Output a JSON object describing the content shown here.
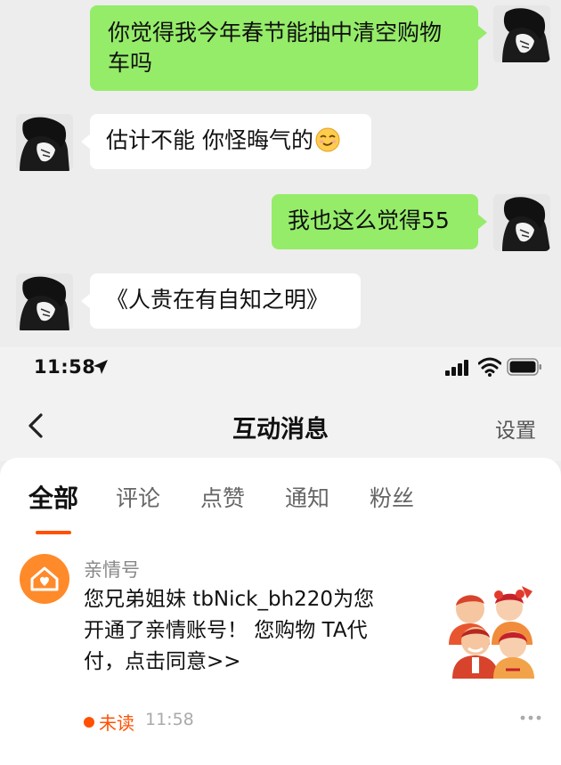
{
  "chat": {
    "messages": [
      {
        "side": "right",
        "text_line1": "你觉得我今年春节能抽中清空购物",
        "text_line2": "车吗"
      },
      {
        "side": "left",
        "text": "估计不能 你怪晦气的",
        "emoji": "smirk-emoji"
      },
      {
        "side": "right",
        "text": "我也这么觉得55"
      },
      {
        "side": "left",
        "text": "《人贵在有自知之明》"
      }
    ],
    "bubble_color_right": "#95ec69",
    "bubble_color_left": "#ffffff"
  },
  "status_bar": {
    "time": "11:58",
    "icons": [
      "location-arrow-icon",
      "signal-icon",
      "wifi-icon",
      "battery-icon"
    ]
  },
  "nav": {
    "back_icon": "chevron-left-icon",
    "title": "互动消息",
    "settings": "设置"
  },
  "tabs": [
    {
      "label": "全部",
      "active": true
    },
    {
      "label": "评论",
      "active": false
    },
    {
      "label": "点赞",
      "active": false
    },
    {
      "label": "通知",
      "active": false
    },
    {
      "label": "粉丝",
      "active": false
    }
  ],
  "notification": {
    "icon": "family-house-icon",
    "sender": "亲情号",
    "line1": "您兄弟姐妹 tbNick_bh220为您",
    "line2": "开通了亲情账号！ 您购物 TA代",
    "line3": "付，点击同意>>",
    "status": "未读",
    "time": "11:58",
    "accent_color": "#ff5000"
  }
}
